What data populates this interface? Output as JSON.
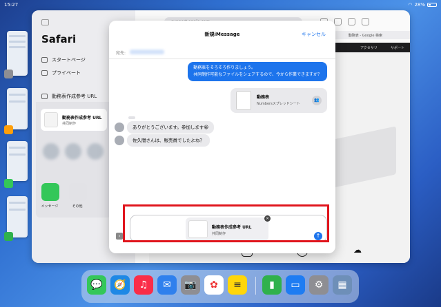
{
  "status_bar": {
    "time": "15:27",
    "battery": "28%"
  },
  "safari": {
    "app_title": "Safari",
    "sidebar_items": [
      "スタートページ",
      "プライベート",
      "動務表作成参考 URL"
    ],
    "url": "support.apple.com",
    "google_tab": "動務表 - Google 検索",
    "nav_items": [
      "アクセサリ",
      "サポート"
    ],
    "footer_icons": [
      "iOS",
      "OS"
    ]
  },
  "share_sheet": {
    "card_title": "動務表作成参考 URL",
    "card_sub": "共同制作",
    "apps": [
      {
        "label": "メッセージ",
        "color": "#34c759"
      },
      {
        "label": "その他",
        "color": "#e2e2e6"
      }
    ]
  },
  "compose": {
    "title": "新規iMessage",
    "cancel_label": "キャンセル",
    "to_label": "宛先:",
    "messages_out": [
      "動務表をそろそろ作りましょう。",
      "共同制作可能なファイルをシェアするので、今から作業できますか？"
    ],
    "file": {
      "name": "動務表",
      "sub": "Numbersスプレッドシート"
    },
    "messages_in": [
      "ありがとうございます。参加します😀",
      "佐久間さんは、販売員でしたよね？"
    ],
    "attachment": {
      "title": "動務表作成参考 URL",
      "sub": "共同制作"
    },
    "send_icon": "arrow-up-icon"
  },
  "dock": {
    "apps": [
      {
        "name": "messages",
        "color": "#34c759",
        "glyph": "💬"
      },
      {
        "name": "safari",
        "color": "#1e88e5",
        "glyph": "🧭"
      },
      {
        "name": "music",
        "color": "#fa2d48",
        "glyph": "♫"
      },
      {
        "name": "mail",
        "color": "#2f80ed",
        "glyph": "✉"
      },
      {
        "name": "camera",
        "color": "#8e8e93",
        "glyph": "📷"
      },
      {
        "name": "photos",
        "color": "#ffffff",
        "glyph": "✿"
      },
      {
        "name": "notes",
        "color": "#ffd60a",
        "glyph": "≡"
      },
      {
        "name": "numbers",
        "color": "#30b14c",
        "glyph": "▮"
      },
      {
        "name": "files",
        "color": "#1e7cf2",
        "glyph": "▭"
      },
      {
        "name": "settings",
        "color": "#8e8e93",
        "glyph": "⚙"
      },
      {
        "name": "app-library",
        "color": "#6e8fb8",
        "glyph": "▦"
      }
    ]
  },
  "colors": {
    "accent": "#1d74ec",
    "highlight": "#e0141c"
  }
}
